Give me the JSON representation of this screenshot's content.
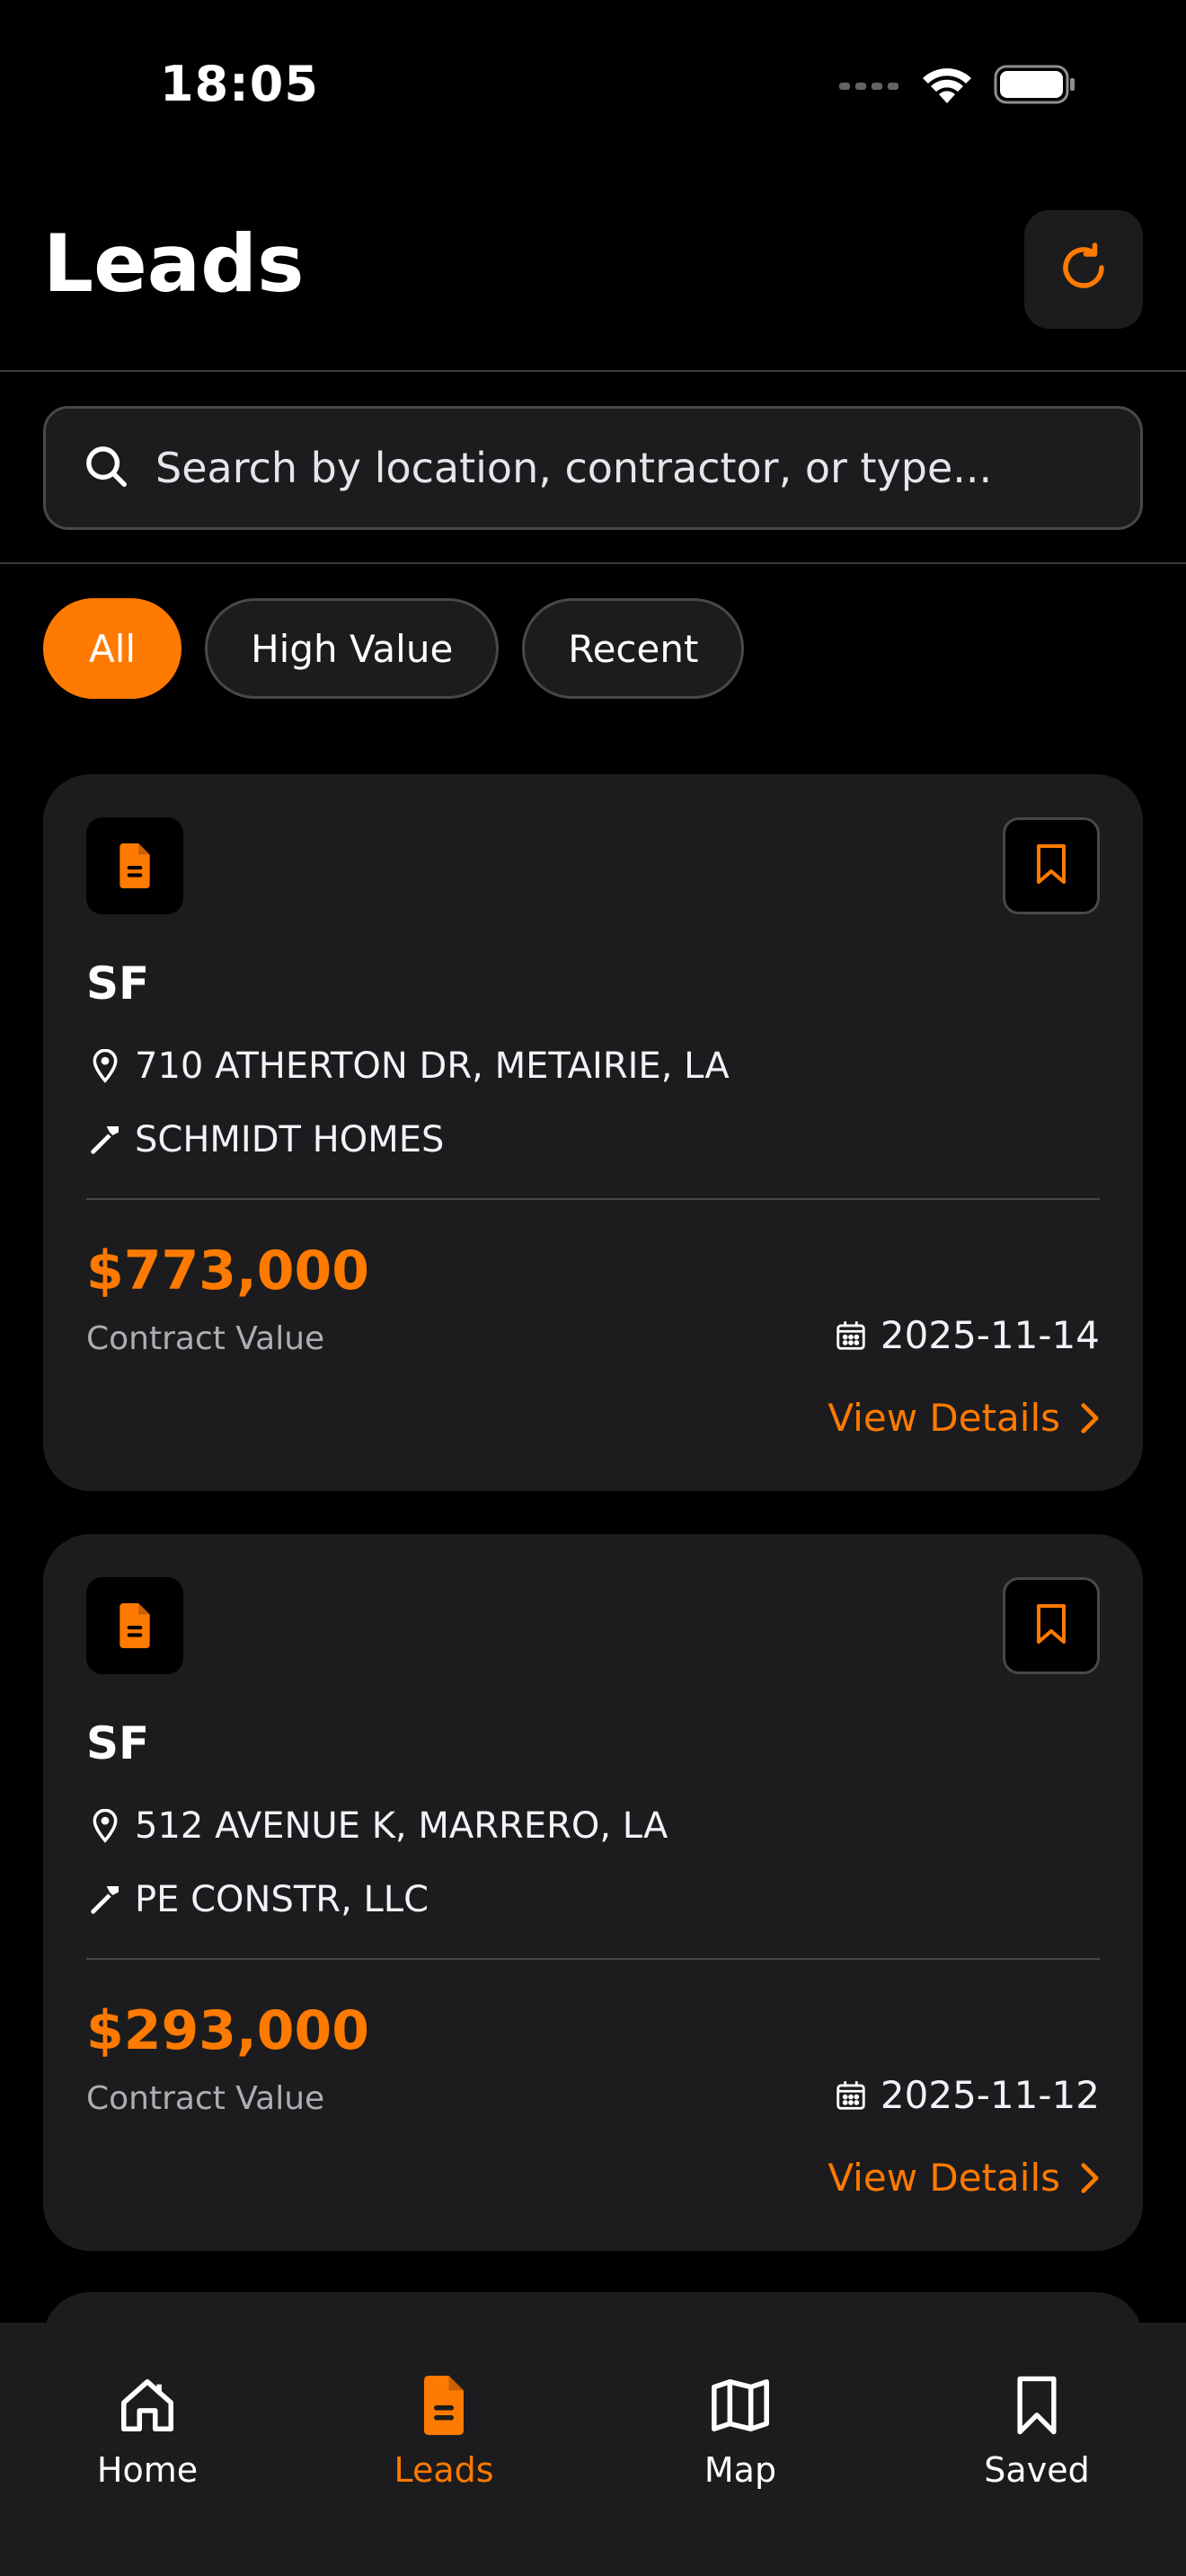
{
  "status_bar": {
    "time": "18:05"
  },
  "header": {
    "title": "Leads",
    "refresh_icon": "refresh-icon"
  },
  "search": {
    "placeholder": "Search by location, contractor, or type..."
  },
  "filters": [
    {
      "label": "All",
      "active": true
    },
    {
      "label": "High Value",
      "active": false
    },
    {
      "label": "Recent",
      "active": false
    }
  ],
  "leads": [
    {
      "type": "SF",
      "address": "710 ATHERTON DR, METAIRIE, LA",
      "contractor": "SCHMIDT HOMES",
      "value": "$773,000",
      "value_label": "Contract Value",
      "date": "2025-11-14",
      "action": "View Details"
    },
    {
      "type": "SF",
      "address": "512 AVENUE K, MARRERO, LA",
      "contractor": "PE CONSTR, LLC",
      "value": "$293,000",
      "value_label": "Contract Value",
      "date": "2025-11-12",
      "action": "View Details"
    }
  ],
  "tabs": [
    {
      "label": "Home",
      "icon": "home-icon",
      "active": false
    },
    {
      "label": "Leads",
      "icon": "document-icon",
      "active": true
    },
    {
      "label": "Map",
      "icon": "map-icon",
      "active": false
    },
    {
      "label": "Saved",
      "icon": "bookmark-icon",
      "active": false
    }
  ],
  "colors": {
    "accent": "#ff7a00",
    "background": "#000000",
    "card": "#1c1c1e",
    "border": "#48484a"
  }
}
